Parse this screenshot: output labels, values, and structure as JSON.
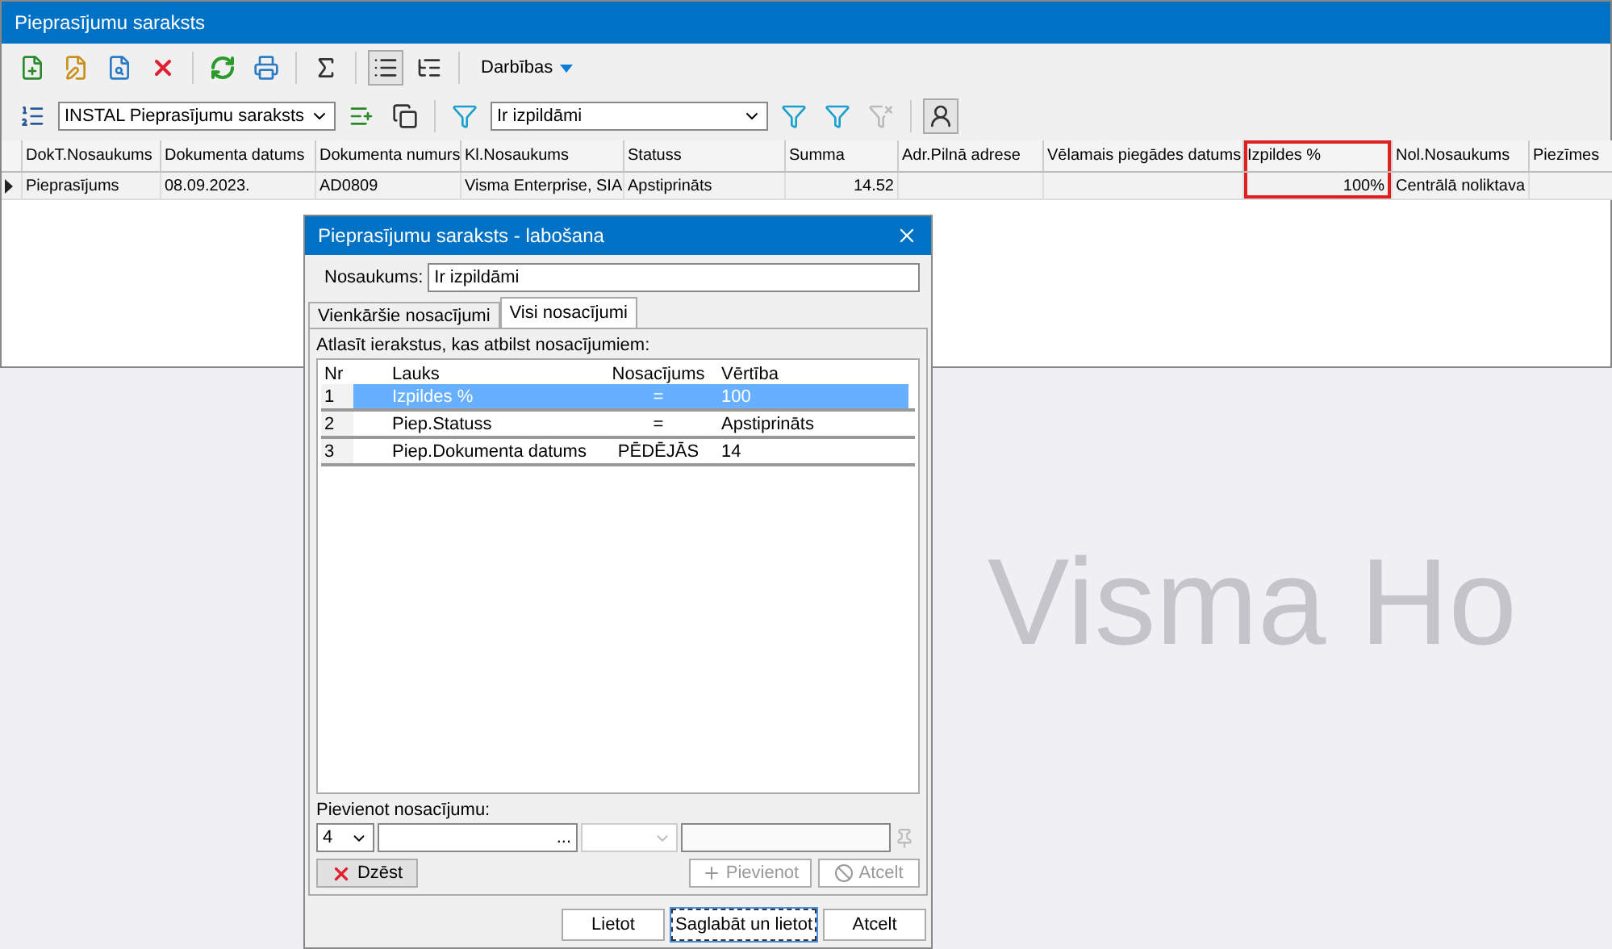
{
  "window": {
    "title": "Pieprasījumu saraksts"
  },
  "toolbar": {
    "actions_menu": "Darbības"
  },
  "view_select": {
    "value": "INSTAL Pieprasījumu saraksts"
  },
  "filter_select": {
    "value": "Ir izpildāmi"
  },
  "table": {
    "columns": [
      {
        "label": "DokT.Nosaukums",
        "highlighted": false
      },
      {
        "label": "Dokumenta datums",
        "highlighted": false
      },
      {
        "label": "Dokumenta numurs",
        "highlighted": false
      },
      {
        "label": "Kl.Nosaukums",
        "highlighted": false
      },
      {
        "label": "Statuss",
        "highlighted": false
      },
      {
        "label": "Summa",
        "highlighted": false
      },
      {
        "label": "Adr.Pilnā adrese",
        "highlighted": false
      },
      {
        "label": "Vēlamais piegādes datums",
        "highlighted": false
      },
      {
        "label": "Izpildes %",
        "highlighted": true
      },
      {
        "label": "Nol.Nosaukums",
        "highlighted": false
      },
      {
        "label": "Piezīmes",
        "highlighted": false
      }
    ],
    "rows": [
      {
        "selected": true,
        "cells": [
          "Pieprasījums",
          "08.09.2023.",
          "AD0809",
          "Visma Enterprise, SIA",
          "Apstiprināts",
          "14.52",
          "",
          "",
          "100%",
          "Centrālā noliktava",
          ""
        ]
      }
    ]
  },
  "background_logo": "Visma Ho",
  "dialog": {
    "title": "Pieprasījumu saraksts - labošana",
    "name_label": "Nosaukums:",
    "name_value": "Ir izpildāmi",
    "tabs": [
      {
        "label": "Vienkāršie nosacījumi",
        "selected": false
      },
      {
        "label": "Visi nosacījumi",
        "selected": true
      }
    ],
    "caption": "Atlasīt ierakstus, kas atbilst nosacījumiem:",
    "columns": [
      "Nr",
      "Lauks",
      "Nosacījums",
      "Vērtība"
    ],
    "rows": [
      {
        "selected": true,
        "cells": [
          "1",
          "Izpildes %",
          "=",
          "100"
        ]
      },
      {
        "selected": false,
        "cells": [
          "2",
          "Piep.Statuss",
          "=",
          "Apstiprināts"
        ]
      },
      {
        "selected": false,
        "cells": [
          "3",
          "Piep.Dokumenta datums",
          "PĒDĒJĀS",
          "14"
        ]
      }
    ],
    "add_group": {
      "label": "Pievienot nosacījumu:",
      "nr": "4",
      "field_button": "...",
      "delete": {
        "label": "Dzēst",
        "disabled": false
      },
      "add": {
        "label": "Pievienot",
        "disabled": true
      },
      "cancel": {
        "label": "Atcelt",
        "disabled": true
      }
    },
    "footer": [
      {
        "label": "Lietot",
        "focused": false
      },
      {
        "label": "Saglabāt un lietot",
        "focused": true
      },
      {
        "label": "Atcelt",
        "focused": false
      }
    ]
  }
}
